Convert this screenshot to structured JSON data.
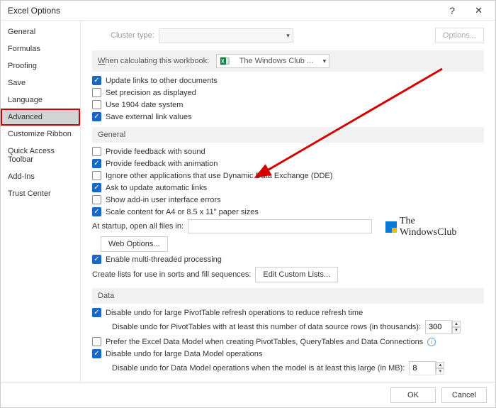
{
  "title": "Excel Options",
  "sidebar": {
    "items": [
      {
        "label": "General"
      },
      {
        "label": "Formulas"
      },
      {
        "label": "Proofing"
      },
      {
        "label": "Save"
      },
      {
        "label": "Language"
      },
      {
        "label": "Advanced"
      },
      {
        "label": "Customize Ribbon"
      },
      {
        "label": "Quick Access Toolbar"
      },
      {
        "label": "Add-Ins"
      },
      {
        "label": "Trust Center"
      }
    ],
    "active_index": 5
  },
  "cluster": {
    "label": "Cluster type:",
    "value": "",
    "options_btn": "Options..."
  },
  "workbook_hdr": {
    "prefix": "W",
    "label1": "hen calculating this workbook:",
    "selected": "The Windows Club ..."
  },
  "calc_checks": {
    "update_links": "Update links to other documents",
    "set_precision": "Set precision as displayed",
    "use_1904": "Use 1904 date system",
    "save_external": "Save external link values"
  },
  "section_general": "General",
  "general_checks": {
    "feedback_sound": "Provide feedback with sound",
    "feedback_anim": "Provide feedback with animation",
    "ignore_dde": "Ignore other applications that use Dynamic Data Exchange (DDE)",
    "ask_update": "Ask to update automatic links",
    "show_addin_err": "Show add-in user interface errors",
    "scale_content": "Scale content for A4 or 8.5 x 11\" paper sizes"
  },
  "startup": {
    "label": "At startup, open all files in:",
    "value": ""
  },
  "web_options": "Web Options...",
  "multi_thread": "Enable multi-threaded processing",
  "create_lists": {
    "label": "Create lists for use in sorts and fill sequences:",
    "btn": "Edit Custom Lists..."
  },
  "section_data": "Data",
  "data_checks": {
    "disable_undo_pivot": "Disable undo for large PivotTable refresh operations to reduce refresh time",
    "pivot_rows_label": "Disable undo for PivotTables with at least this number of data source rows (in thousands):",
    "pivot_rows_value": "300",
    "prefer_datamodel": "Prefer the Excel Data Model when creating PivotTables, QueryTables and Data Connections",
    "disable_undo_dm": "Disable undo for large Data Model operations",
    "dm_label": "Disable undo for Data Model operations when the model is at least this large (in MB):",
    "dm_value": "8"
  },
  "footer": {
    "ok": "OK",
    "cancel": "Cancel"
  },
  "watermark": {
    "line1": "The",
    "line2": "WindowsClub"
  }
}
